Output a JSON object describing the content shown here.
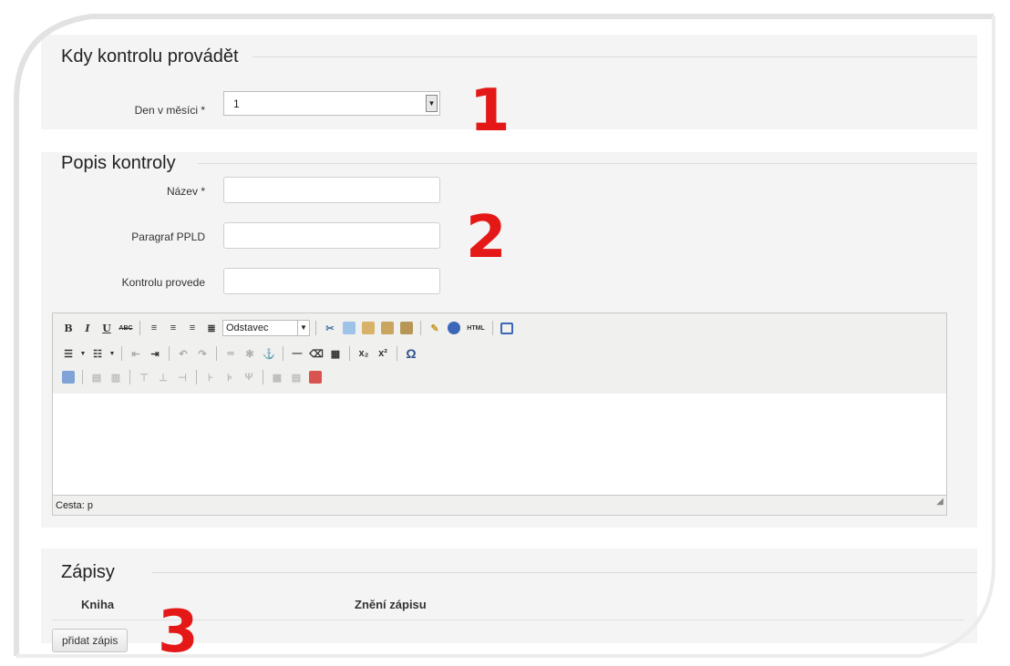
{
  "sections": {
    "when": {
      "legend": "Kdy kontrolu provádět",
      "day_label": "Den v měsíci *",
      "day_value": "1",
      "marker": "1"
    },
    "description": {
      "legend": "Popis kontroly",
      "name_label": "Název *",
      "paragraph_label": "Paragraf PPLD",
      "performer_label": "Kontrolu provede",
      "marker": "2",
      "editor": {
        "format_select": "Odstavec",
        "status_path": "Cesta: p",
        "toolbar_row1": [
          "B",
          "I",
          "U",
          "ABC"
        ],
        "html_label": "HTML",
        "subscript": "x₂",
        "superscript": "x²",
        "omega": "Ω"
      }
    },
    "records": {
      "legend": "Zápisy",
      "col_book": "Kniha",
      "col_text": "Znění zápisu",
      "add_button": "přidat zápis",
      "marker": "3"
    }
  }
}
